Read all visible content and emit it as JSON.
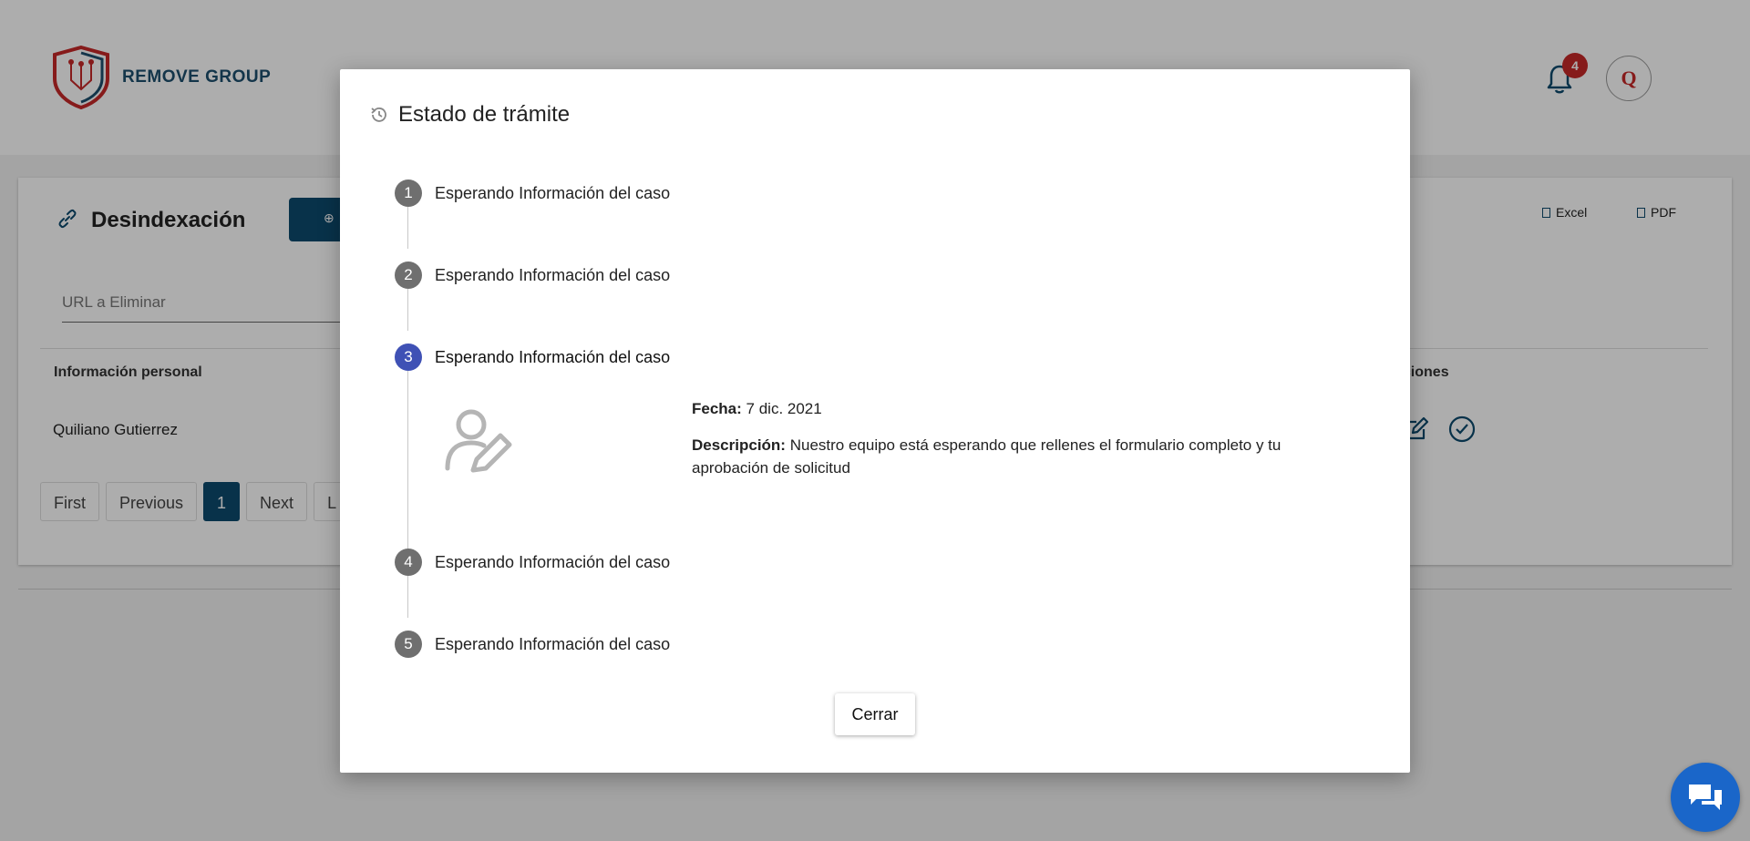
{
  "header": {
    "brand": "REMOVE GROUP",
    "notification_count": "4",
    "avatar_initial": "Q"
  },
  "page": {
    "title": "Desindexación",
    "export_excel": "Excel",
    "export_pdf": "PDF",
    "url_placeholder": "URL a Eliminar",
    "columns": [
      "Información personal",
      "cciones"
    ],
    "row": {
      "name": "Quiliano Gutierrez"
    },
    "pagination": [
      "First",
      "Previous",
      "1",
      "Next",
      "L"
    ]
  },
  "modal": {
    "title": "Estado de trámite",
    "steps": [
      {
        "number": "1",
        "label": "Esperando Información del caso"
      },
      {
        "number": "2",
        "label": "Esperando Información del caso"
      },
      {
        "number": "3",
        "label": "Esperando Información del caso"
      },
      {
        "number": "4",
        "label": "Esperando Información del caso"
      },
      {
        "number": "5",
        "label": "Esperando Información del caso"
      }
    ],
    "active_step": 3,
    "detail": {
      "fecha_label": "Fecha:",
      "fecha_value": "7 dic. 2021",
      "descripcion_label": "Descripción:",
      "descripcion_value": "Nuestro equipo está esperando que rellenes el formulario completo y tu aprobación de solicitud"
    },
    "close_label": "Cerrar"
  },
  "colors": {
    "primary": "#0d4a6e",
    "active_step": "#3f51b5",
    "inactive_step": "#6f6f6f",
    "badge": "#c62828",
    "chat": "#1a66c9"
  },
  "icons": [
    "shield-logo-icon",
    "bell-icon",
    "link-icon",
    "plus-circle-icon",
    "document-icon",
    "history-icon",
    "user-edit-icon",
    "edit-icon",
    "check-circle-icon",
    "chat-icon"
  ]
}
